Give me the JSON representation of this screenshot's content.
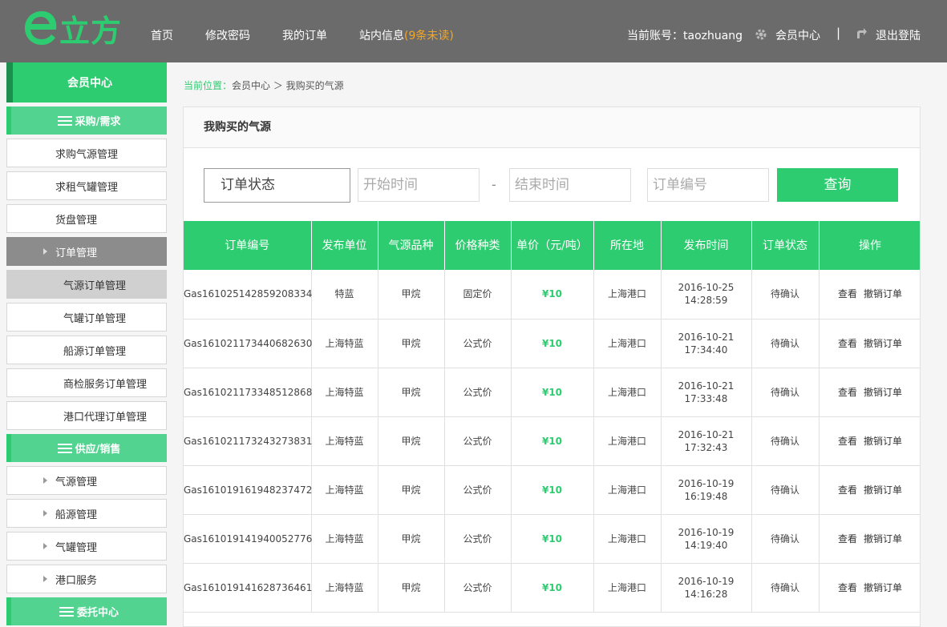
{
  "header": {
    "logo_text": "立方",
    "nav": [
      {
        "label": "首页"
      },
      {
        "label": "修改密码"
      },
      {
        "label": "我的订单"
      },
      {
        "label": "站内信息",
        "badge": "(9条未读)"
      }
    ],
    "account_label": "当前账号：taozhuang",
    "member_center": "会员中心",
    "divider": "|",
    "logout": "退出登陆",
    "brand_color": "#2ecc71"
  },
  "sidebar": {
    "title": "会员中心",
    "sections": [
      {
        "label": "采购/需求",
        "icon": "menu-icon"
      },
      {
        "label": "供应/销售",
        "icon": "menu-icon"
      },
      {
        "label": "委托中心",
        "icon": "menu-icon"
      }
    ],
    "purchase_items": [
      "求购气源管理",
      "求租气罐管理",
      "货盘管理"
    ],
    "order_mgmt": "订单管理",
    "order_sub": [
      "气源订单管理",
      "气罐订单管理",
      "船源订单管理",
      "商检服务订单管理",
      "港口代理订单管理"
    ],
    "supply_items": [
      "气源管理",
      "船源管理",
      "气罐管理",
      "港口服务"
    ]
  },
  "breadcrumb": {
    "prefix": "当前位置：",
    "path": "会员中心 ＞ 我购买的气源"
  },
  "panel": {
    "title": "我购买的气源",
    "filters": {
      "status": "订单状态",
      "start_placeholder": "开始时间",
      "dash": "-",
      "end_placeholder": "结束时间",
      "order_no_placeholder": "订单编号",
      "query": "查询"
    },
    "table": {
      "headers": [
        "订单编号",
        "发布单位",
        "气源品种",
        "价格种类",
        "单价（元/吨）",
        "所在地",
        "发布时间",
        "订单状态",
        "操作"
      ],
      "view_label": "查看",
      "cancel_label": "撤销订单",
      "rows": [
        {
          "no": "Gas161025142859208334",
          "unit": "特蓝",
          "kind": "甲烷",
          "price_type": "固定价",
          "price": "¥10",
          "place": "上海港口",
          "date": "2016-10-25",
          "time": "14:28:59",
          "status": "待确认"
        },
        {
          "no": "Gas161021173440682630",
          "unit": "上海特蓝",
          "kind": "甲烷",
          "price_type": "公式价",
          "price": "¥10",
          "place": "上海港口",
          "date": "2016-10-21",
          "time": "17:34:40",
          "status": "待确认"
        },
        {
          "no": "Gas161021173348512868",
          "unit": "上海特蓝",
          "kind": "甲烷",
          "price_type": "公式价",
          "price": "¥10",
          "place": "上海港口",
          "date": "2016-10-21",
          "time": "17:33:48",
          "status": "待确认"
        },
        {
          "no": "Gas161021173243273831",
          "unit": "上海特蓝",
          "kind": "甲烷",
          "price_type": "公式价",
          "price": "¥10",
          "place": "上海港口",
          "date": "2016-10-21",
          "time": "17:32:43",
          "status": "待确认"
        },
        {
          "no": "Gas161019161948237472",
          "unit": "上海特蓝",
          "kind": "甲烷",
          "price_type": "公式价",
          "price": "¥10",
          "place": "上海港口",
          "date": "2016-10-19",
          "time": "16:19:48",
          "status": "待确认"
        },
        {
          "no": "Gas161019141940052776",
          "unit": "上海特蓝",
          "kind": "甲烷",
          "price_type": "公式价",
          "price": "¥10",
          "place": "上海港口",
          "date": "2016-10-19",
          "time": "14:19:40",
          "status": "待确认"
        },
        {
          "no": "Gas161019141628736461",
          "unit": "上海特蓝",
          "kind": "甲烷",
          "price_type": "公式价",
          "price": "¥10",
          "place": "上海港口",
          "date": "2016-10-19",
          "time": "14:16:28",
          "status": "待确认"
        }
      ]
    }
  }
}
